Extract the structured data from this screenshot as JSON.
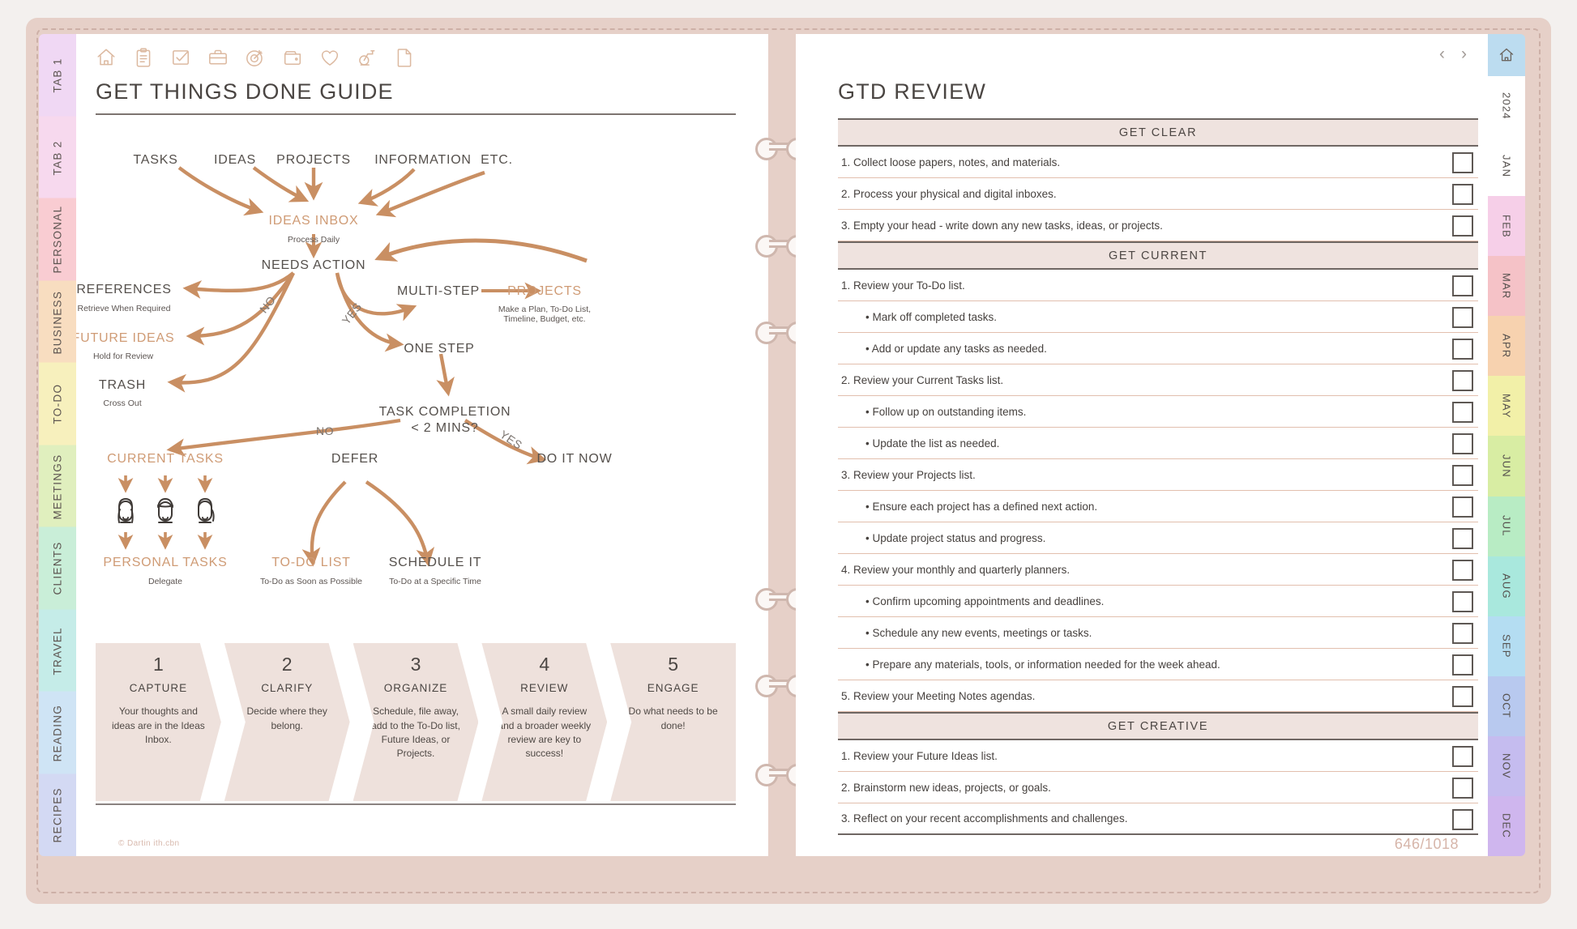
{
  "left_page": {
    "title": "GET THINGS DONE GUIDE",
    "icons": [
      {
        "name": "home-icon",
        "label": "Home"
      },
      {
        "name": "clipboard-icon",
        "label": "Notes"
      },
      {
        "name": "checkbox-icon",
        "label": "Tasks"
      },
      {
        "name": "briefcase-icon",
        "label": "Work"
      },
      {
        "name": "target-icon",
        "label": "Goals"
      },
      {
        "name": "wallet-icon",
        "label": "Finance"
      },
      {
        "name": "heart-icon",
        "label": "Health"
      },
      {
        "name": "exercise-bike-icon",
        "label": "Fitness"
      },
      {
        "name": "document-icon",
        "label": "Pages"
      }
    ],
    "flow": {
      "inputs": [
        "TASKS",
        "IDEAS",
        "PROJECTS",
        "INFORMATION",
        "ETC."
      ],
      "inbox": {
        "label": "IDEAS INBOX",
        "caption": "Process Daily"
      },
      "needs_action": "NEEDS ACTION",
      "branch_no": "NO",
      "branch_yes": "YES",
      "references": {
        "label": "REFERENCES",
        "caption": "Retrieve When Required"
      },
      "future_ideas": {
        "label": "FUTURE IDEAS",
        "caption": "Hold for Review"
      },
      "trash": {
        "label": "TRASH",
        "caption": "Cross Out"
      },
      "multi_step": "MULTI-STEP",
      "projects": {
        "label": "PROJECTS",
        "caption_line1": "Make a Plan, To-Do List,",
        "caption_line2": "Timeline, Budget, etc."
      },
      "one_step": "ONE STEP",
      "task_completion": {
        "line1": "TASK COMPLETION",
        "line2": "< 2 MINS?"
      },
      "completion_no": "NO",
      "completion_yes": "YES",
      "current_tasks": "CURRENT TASKS",
      "personal_tasks": {
        "label": "PERSONAL TASKS",
        "caption": "Delegate"
      },
      "defer": "DEFER",
      "todo_list": {
        "label": "TO-DO LIST",
        "caption": "To-Do as Soon as Possible"
      },
      "schedule_it": {
        "label": "SCHEDULE IT",
        "caption": "To-Do at a Specific Time"
      },
      "do_it_now": "DO IT NOW"
    },
    "steps": [
      {
        "num": "1",
        "label": "CAPTURE",
        "desc": "Your thoughts and ideas are in the Ideas Inbox."
      },
      {
        "num": "2",
        "label": "CLARIFY",
        "desc": "Decide where they belong."
      },
      {
        "num": "3",
        "label": "ORGANIZE",
        "desc": "Schedule, file away, add to the To-Do list, Future Ideas, or Projects."
      },
      {
        "num": "4",
        "label": "REVIEW",
        "desc": "A small daily review and a broader weekly review are key to success!"
      },
      {
        "num": "5",
        "label": "ENGAGE",
        "desc": "Do what needs to be done!"
      }
    ]
  },
  "right_page": {
    "title": "GTD REVIEW",
    "pager": {
      "prev": "‹",
      "next": "›"
    },
    "sections": [
      {
        "heading": "GET CLEAR",
        "items": [
          {
            "text": "1. Collect loose papers, notes, and materials.",
            "sub": false,
            "checked": false
          },
          {
            "text": "2. Process your physical and digital inboxes.",
            "sub": false,
            "checked": false
          },
          {
            "text": "3. Empty your head - write down any new tasks, ideas, or projects.",
            "sub": false,
            "checked": false
          }
        ]
      },
      {
        "heading": "GET CURRENT",
        "items": [
          {
            "text": "1. Review your To-Do list.",
            "sub": false,
            "checked": false
          },
          {
            "text": "• Mark off completed tasks.",
            "sub": true,
            "checked": false
          },
          {
            "text": "• Add or update any tasks as needed.",
            "sub": true,
            "checked": false
          },
          {
            "text": "2. Review your Current Tasks list.",
            "sub": false,
            "checked": false
          },
          {
            "text": "• Follow up on outstanding items.",
            "sub": true,
            "checked": false
          },
          {
            "text": "• Update the list as needed.",
            "sub": true,
            "checked": false
          },
          {
            "text": "3. Review your Projects list.",
            "sub": false,
            "checked": false
          },
          {
            "text": "• Ensure each project has a defined next action.",
            "sub": true,
            "checked": false
          },
          {
            "text": "• Update project status and progress.",
            "sub": true,
            "checked": false
          },
          {
            "text": "4. Review your monthly and quarterly planners.",
            "sub": false,
            "checked": false
          },
          {
            "text": "• Confirm upcoming appointments and deadlines.",
            "sub": true,
            "checked": false
          },
          {
            "text": "• Schedule any new events, meetings or tasks.",
            "sub": true,
            "checked": false
          },
          {
            "text": "• Prepare any materials, tools, or information needed for the week ahead.",
            "sub": true,
            "checked": false
          },
          {
            "text": "5. Review your Meeting Notes agendas.",
            "sub": false,
            "checked": false
          }
        ]
      },
      {
        "heading": "GET CREATIVE",
        "items": [
          {
            "text": "1. Review your Future Ideas list.",
            "sub": false,
            "checked": false
          },
          {
            "text": "2. Brainstorm new ideas, projects, or goals.",
            "sub": false,
            "checked": false
          },
          {
            "text": "3. Reflect on your recent accomplishments and challenges.",
            "sub": false,
            "checked": false
          }
        ]
      }
    ]
  },
  "left_tabs": [
    {
      "label": "TAB 1",
      "color": "#f0d8f4"
    },
    {
      "label": "TAB 2",
      "color": "#f7d9ee"
    },
    {
      "label": "PERSONAL",
      "color": "#f9ccd2"
    },
    {
      "label": "BUSINESS",
      "color": "#f8ddc0"
    },
    {
      "label": "TO-DO",
      "color": "#f7f0bd"
    },
    {
      "label": "MEETINGS",
      "color": "#e0efbe"
    },
    {
      "label": "CLIENTS",
      "color": "#c9eed8"
    },
    {
      "label": "TRAVEL",
      "color": "#c5ece8"
    },
    {
      "label": "READING",
      "color": "#cfe4f5"
    },
    {
      "label": "RECIPES",
      "color": "#d3d9f3"
    }
  ],
  "right_tabs": [
    {
      "label": "",
      "color": "#bcdcf0",
      "icon": "home-icon"
    },
    {
      "label": "2024",
      "color": "#ffffff"
    },
    {
      "label": "JAN",
      "color": "#ffffff"
    },
    {
      "label": "FEB",
      "color": "#f6cfe8"
    },
    {
      "label": "MAR",
      "color": "#f5c2c7"
    },
    {
      "label": "APR",
      "color": "#f7d2af"
    },
    {
      "label": "MAY",
      "color": "#f2f0a8"
    },
    {
      "label": "JUN",
      "color": "#d8eda3"
    },
    {
      "label": "JUL",
      "color": "#b8ecc4"
    },
    {
      "label": "AUG",
      "color": "#a9e8dd"
    },
    {
      "label": "SEP",
      "color": "#b4ddf2"
    },
    {
      "label": "OCT",
      "color": "#b8c9ef"
    },
    {
      "label": "NOV",
      "color": "#c5bcef"
    },
    {
      "label": "DEC",
      "color": "#cfb6ee"
    }
  ],
  "footer": {
    "credit": "© Dartin ith.cbn",
    "page_number": "646/1018"
  },
  "colors": {
    "frame": "#e6d0c8",
    "accent": "#c98f63",
    "accent_light": "#d9a478",
    "ink": "#4a4542",
    "section_bg": "#efe3df"
  }
}
